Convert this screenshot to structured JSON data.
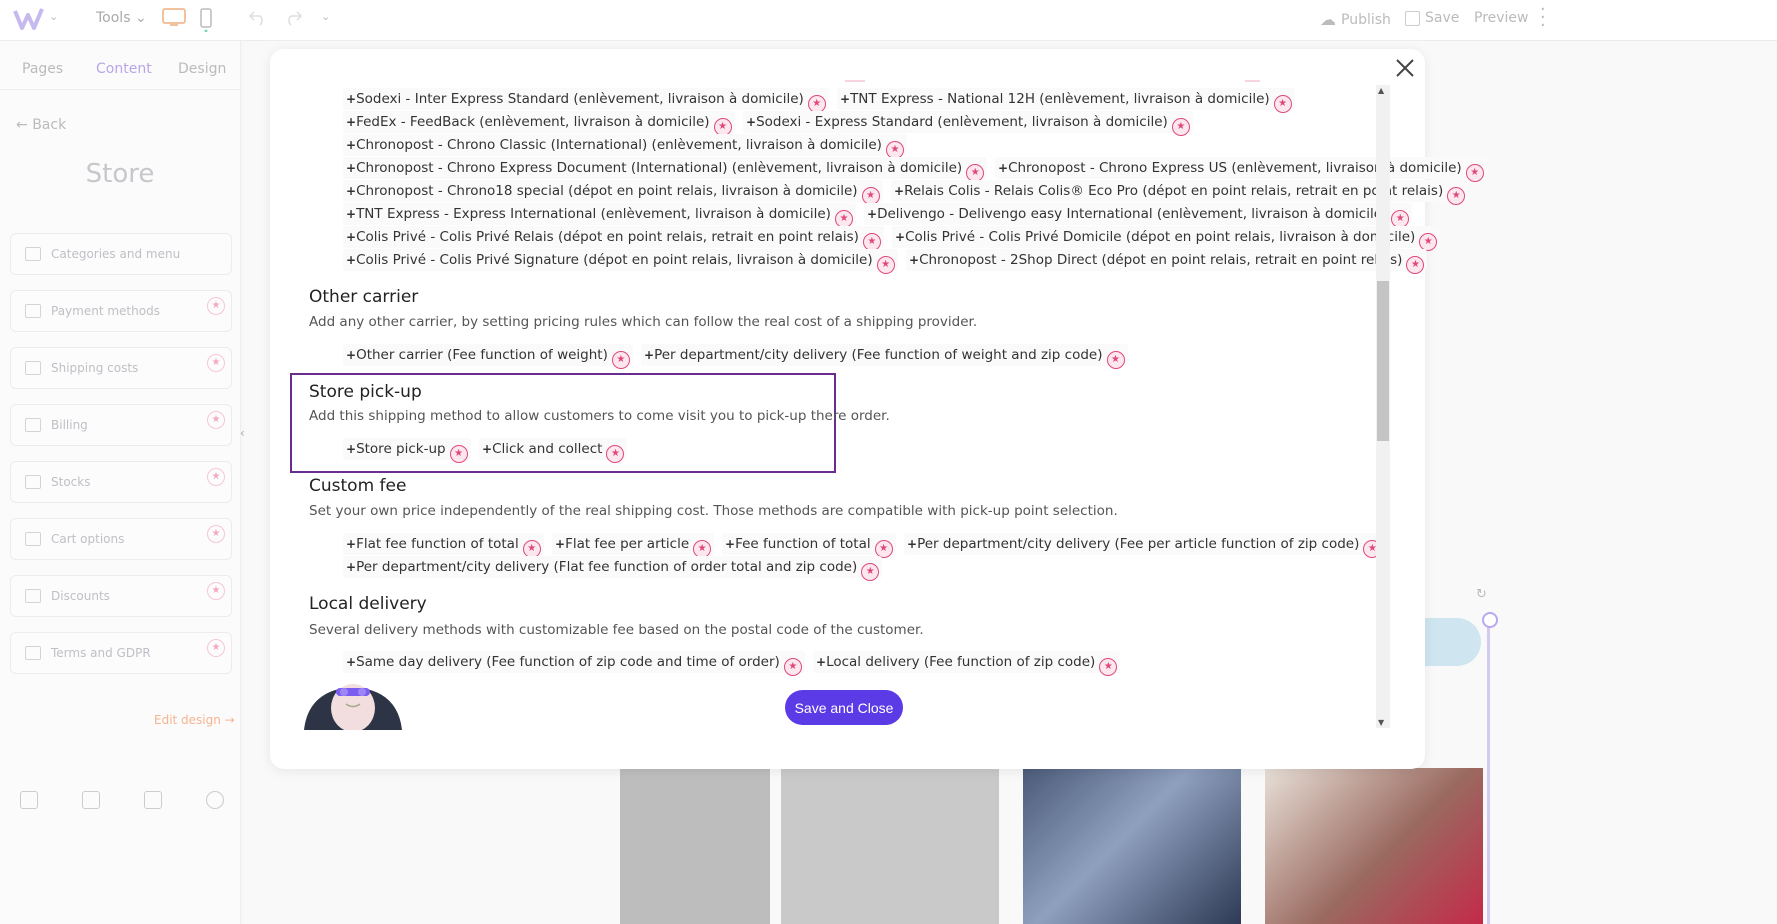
{
  "topbar": {
    "tools_label": "Tools",
    "publish_label": "Publish",
    "save_label": "Save",
    "preview_label": "Preview"
  },
  "sidebar": {
    "tabs": [
      {
        "label": "Pages"
      },
      {
        "label": "Content"
      },
      {
        "label": "Design"
      }
    ],
    "back_label": "Back",
    "title": "Store",
    "items": [
      {
        "label": "Categories and menu",
        "icon": "folder-icon",
        "premium": false
      },
      {
        "label": "Payment methods",
        "icon": "card-icon",
        "premium": true
      },
      {
        "label": "Shipping costs",
        "icon": "truck-icon",
        "premium": true
      },
      {
        "label": "Billing",
        "icon": "clipboard-icon",
        "premium": true
      },
      {
        "label": "Stocks",
        "icon": "box-icon",
        "premium": true
      },
      {
        "label": "Cart options",
        "icon": "grid-icon",
        "premium": true
      },
      {
        "label": "Discounts",
        "icon": "tag-icon",
        "premium": true
      },
      {
        "label": "Terms and GDPR",
        "icon": "document-icon",
        "premium": true
      }
    ],
    "edit_design_label": "Edit design →"
  },
  "modal": {
    "carrier_rows": [
      [
        "Sodexi - Inter Express Standard (enlèvement, livraison à domicile)",
        "TNT Express - National 12H (enlèvement, livraison à domicile)"
      ],
      [
        "FedEx - FeedBack (enlèvement, livraison à domicile)",
        "Sodexi - Express Standard (enlèvement, livraison à domicile)"
      ],
      [
        "Chronopost - Chrono Classic (International) (enlèvement, livraison à domicile)"
      ],
      [
        "Chronopost - Chrono Express Document (International) (enlèvement, livraison à domicile)",
        "Chronopost - Chrono Express US (enlèvement, livraison à domicile)"
      ],
      [
        "Chronopost - Chrono18 special (dépot en point relais, livraison à domicile)",
        "Relais Colis - Relais Colis® Eco Pro (dépot en point relais, retrait en point relais)"
      ],
      [
        "TNT Express - Express International (enlèvement, livraison à domicile)",
        "Delivengo - Delivengo easy International (enlèvement, livraison à domicile)"
      ],
      [
        "Colis Privé - Colis Privé Relais (dépot en point relais, retrait en point relais)",
        "Colis Privé - Colis Privé Domicile (dépot en point relais, livraison à domicile)"
      ],
      [
        "Colis Privé - Colis Privé Signature (dépot en point relais, livraison à domicile)",
        "Chronopost - 2Shop Direct (dépot en point relais, retrait en point relais)"
      ]
    ],
    "sections": {
      "other": {
        "title": "Other carrier",
        "desc": "Add any other carrier, by setting pricing rules which can follow the real cost of a shipping provider.",
        "chips": [
          "Other carrier (Fee function of weight)",
          "Per department/city delivery (Fee function of weight and zip code)"
        ]
      },
      "pickup": {
        "title": "Store pick-up",
        "desc": "Add this shipping method to allow customers to come visit you to pick-up there order.",
        "chips": [
          "Store pick-up",
          "Click and collect"
        ]
      },
      "custom": {
        "title": "Custom fee",
        "desc": "Set your own price independently of the real shipping cost. Those methods are compatible with pick-up point selection.",
        "chips_row1": [
          "Flat fee function of total",
          "Flat fee per article",
          "Fee function of total",
          "Per department/city delivery (Fee per article function of zip code)"
        ],
        "chips_row2": [
          "Per department/city delivery (Flat fee function of order total and zip code)"
        ]
      },
      "local": {
        "title": "Local delivery",
        "desc": "Several delivery methods with customizable fee based on the postal code of the customer.",
        "chips": [
          "Same day delivery (Fee function of zip code and time of order)",
          "Local delivery (Fee function of zip code)"
        ]
      }
    },
    "save_close_label": "Save and Close"
  },
  "colors": {
    "accent": "#5b3be6",
    "highlight_border": "#6a2d8f",
    "premium_star": "#e0487b"
  }
}
